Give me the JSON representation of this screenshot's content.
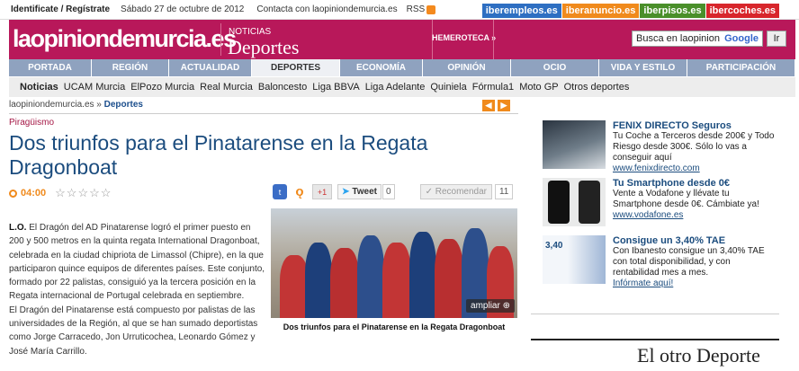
{
  "topbar": {
    "account": "Identificate / Regístrate",
    "date": "Sábado 27 de octubre de 2012",
    "contact": "Contacta con laopiniondemurcia.es",
    "rss": "RSS",
    "sites": [
      {
        "label": "iberempleos.es",
        "color": "#2e6fc2"
      },
      {
        "label": "iberanuncio.es",
        "color": "#f08a1c"
      },
      {
        "label": "iberpisos.es",
        "color": "#4a8f2a"
      },
      {
        "label": "ibercoches.es",
        "color": "#d8262c"
      }
    ]
  },
  "header": {
    "logo_a": "laopinionde",
    "logo_b": "murcia",
    "logo_c": ".es",
    "noticias": "NOTICIAS",
    "section": "Deportes",
    "hemeroteca": "HEMEROTECA »",
    "search_placeholder": "Busca en laopinion",
    "google": "Google",
    "go": "Ir"
  },
  "nav": [
    {
      "label": "PORTADA",
      "w": 92
    },
    {
      "label": "REGIÓN",
      "w": 86
    },
    {
      "label": "ACTUALIDAD",
      "w": 92
    },
    {
      "label": "DEPORTES",
      "w": 98,
      "active": true
    },
    {
      "label": "ECONOMÍA",
      "w": 92
    },
    {
      "label": "OPINIÓN",
      "w": 98
    },
    {
      "label": "OCIO",
      "w": 98
    },
    {
      "label": "VIDA Y ESTILO",
      "w": 98
    },
    {
      "label": "PARTICIPACIÓN",
      "w": 120
    }
  ],
  "subnav": [
    "Noticias",
    "UCAM Murcia",
    "ElPozo Murcia",
    "Real Murcia",
    "Baloncesto",
    "Liga BBVA",
    "Liga Adelante",
    "Quiniela",
    "Fórmula1",
    "Moto GP",
    "Otros deportes"
  ],
  "breadcrumb": {
    "site": "laopiniondemurcia.es",
    "sep": " » ",
    "section": "Deportes"
  },
  "article": {
    "kicker": "Piragüismo",
    "headline": "Dos triunfos para el Pinatarense en la Regata Dragonboat",
    "time": "04:00",
    "stars": "☆☆☆☆☆",
    "gplus": "+1",
    "tweet": "Tweet",
    "tweet_count": "0",
    "recomendar": "✓ Recomendar",
    "reco_count": "11",
    "lead": "L.O.",
    "body1": " El Dragón del AD Pinatarense logró el primer puesto en 200 y 500 metros en la quinta regata International Dragonboat, celebrada en la ciudad chipriota de Limassol (Chipre), en la que participaron quince equipos de diferentes países. Este conjunto, formado por 22 palistas, consiguió ya la tercera posición en la Regata internacional de Portugal celebrada en septiembre.",
    "body2": "El Dragón del Pinatarense está compuesto por palistas de las universidades de la Región, al que se han sumado deportistas como Jorge Carracedo, Jon Urruticochea, Leonardo Gómez y José María Carrillo.",
    "ampliar": "ampliar",
    "caption": "Dos triunfos para el Pinatarense en la Regata Dragonboat"
  },
  "ads": [
    {
      "title": "FENIX DIRECTO Seguros",
      "text": "Tu Coche a Terceros desde 200€ y Todo Riesgo desde 300€. Sólo lo vas a conseguir aquí",
      "link": "www.fenixdirecto.com"
    },
    {
      "title": "Tu Smartphone desde 0€",
      "text": "Vente a Vodafone y llévate tu Smartphone desde 0€. Cámbiate ya!",
      "link": "www.vodafone.es"
    },
    {
      "title": "Consigue un 3,40% TAE",
      "text": "Con Ibanesto consigue un 3,40% TAE con total disponibilidad, y con rentabilidad mes a mes.",
      "link": "Infórmate aquí!",
      "badge": "3,40"
    }
  ],
  "otro": "El otro Deporte"
}
